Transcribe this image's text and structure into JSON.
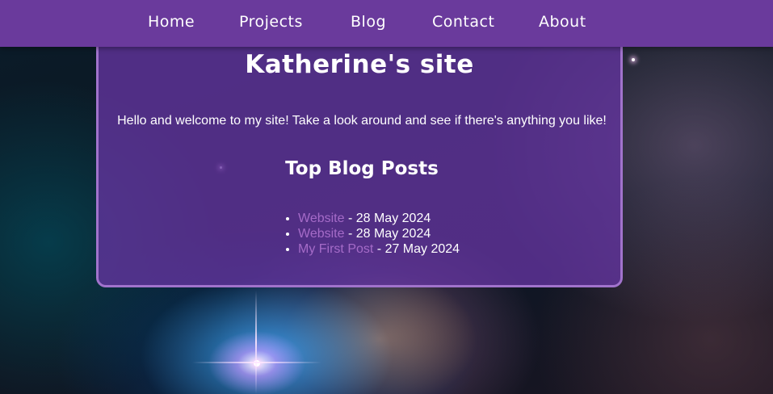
{
  "nav": {
    "items": [
      {
        "label": "Home"
      },
      {
        "label": "Projects"
      },
      {
        "label": "Blog"
      },
      {
        "label": "Contact"
      },
      {
        "label": "About"
      }
    ]
  },
  "main": {
    "title": "Katherine's site",
    "welcome": "Hello and welcome to my site! Take a look around and see if there's anything you like!",
    "top_posts": {
      "heading": "Top Blog Posts",
      "posts": [
        {
          "title": "Website",
          "date": " - 28 May 2024"
        },
        {
          "title": "Website",
          "date": " - 28 May 2024"
        },
        {
          "title": "My First Post",
          "date": " - 27 May 2024"
        }
      ]
    }
  },
  "colors": {
    "nav_background": "#6a3a9c",
    "card_background": "#6434a0",
    "card_border": "#a173cc",
    "link": "#a56bc8",
    "text": "#ffffff"
  }
}
